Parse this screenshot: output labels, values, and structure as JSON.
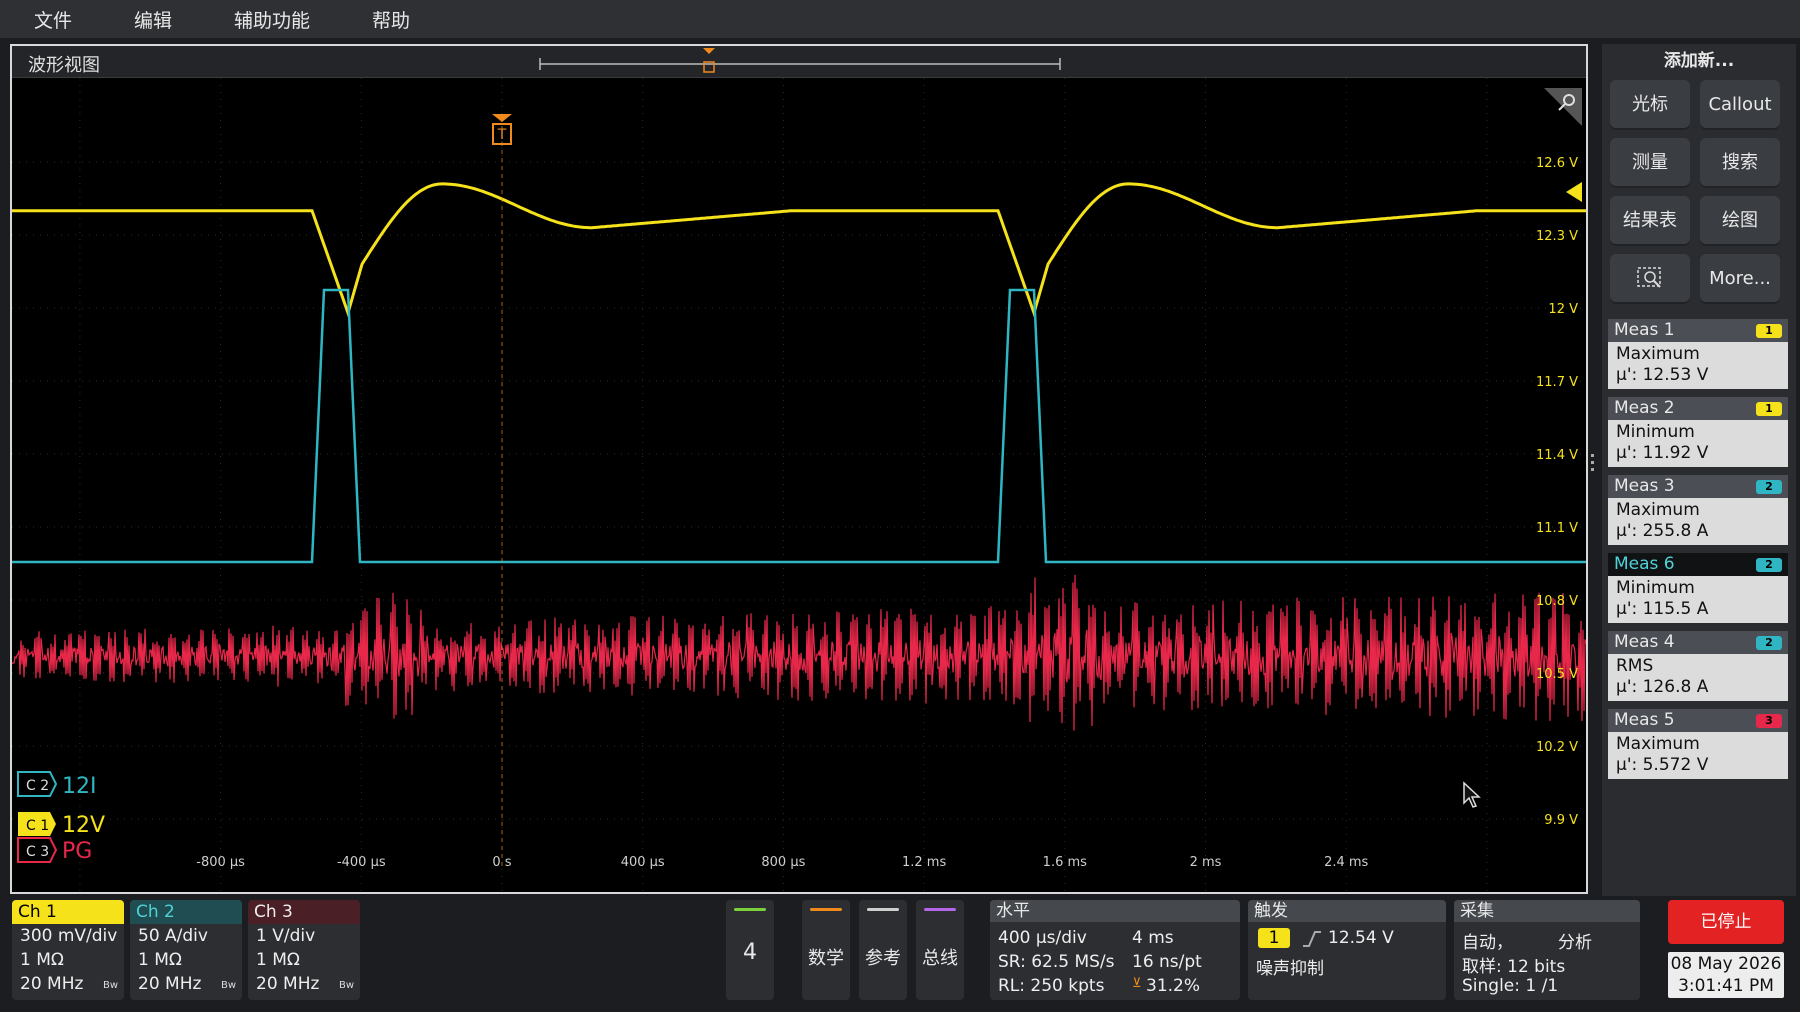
{
  "menu": [
    "文件",
    "编辑",
    "辅助功能",
    "帮助"
  ],
  "waveform_view": {
    "title": "波形视图",
    "x_ticks": [
      "-800 µs",
      "-400 µs",
      "0 s",
      "400 µs",
      "800 µs",
      "1.2 ms",
      "1.6 ms",
      "2 ms",
      "2.4 ms"
    ],
    "y_ticks": [
      "12.6 V",
      "12.3 V",
      "12 V",
      "11.7 V",
      "11.4 V",
      "11.1 V",
      "10.8 V",
      "10.5 V",
      "10.2 V",
      "9.9 V"
    ],
    "trigger_marker": "T",
    "channel_labels": [
      {
        "tag": "C 2",
        "name": "12I",
        "color": "#2fb6c2"
      },
      {
        "tag": "C 1",
        "name": "12V",
        "color": "#f5e21b"
      },
      {
        "tag": "C 3",
        "name": "PG",
        "color": "#e8284a"
      }
    ],
    "ch1_color": "#f5e21b",
    "ch2_color": "#2fb6c2",
    "ch3_color": "#e8284a"
  },
  "right_panel": {
    "add_new": "添加新...",
    "buttons": [
      "光标",
      "Callout",
      "测量",
      "搜索",
      "结果表",
      "绘图",
      "",
      "More..."
    ],
    "zoom_icon": "zoom-region-icon",
    "measurements": [
      {
        "name": "Meas 1",
        "badge": "1",
        "type": "Maximum",
        "value": "µ': 12.53 V",
        "selected": false
      },
      {
        "name": "Meas 2",
        "badge": "1",
        "type": "Minimum",
        "value": "µ': 11.92 V",
        "selected": false
      },
      {
        "name": "Meas 3",
        "badge": "2",
        "type": "Maximum",
        "value": "µ': 255.8 A",
        "selected": false
      },
      {
        "name": "Meas 6",
        "badge": "2",
        "type": "Minimum",
        "value": "µ': 115.5 A",
        "selected": true
      },
      {
        "name": "Meas 4",
        "badge": "2",
        "type": "RMS",
        "value": "µ': 126.8 A",
        "selected": false
      },
      {
        "name": "Meas 5",
        "badge": "3",
        "type": "Maximum",
        "value": "µ': 5.572 V",
        "selected": false
      }
    ]
  },
  "channels": [
    {
      "label": "Ch 1",
      "scale": "300 mV/div",
      "impedance": "1 MΩ",
      "bandwidth": "20 MHz",
      "bw": "Bw"
    },
    {
      "label": "Ch 2",
      "scale": "50 A/div",
      "impedance": "1 MΩ",
      "bandwidth": "20 MHz",
      "bw": "Bw"
    },
    {
      "label": "Ch 3",
      "scale": "1 V/div",
      "impedance": "1 MΩ",
      "bandwidth": "20 MHz",
      "bw": "Bw"
    }
  ],
  "add_buttons": [
    "4",
    "数学",
    "参考",
    "总线"
  ],
  "horizontal": {
    "title": "水平",
    "scale": "400 µs/div",
    "span": "4 ms",
    "sr": "SR: 62.5 MS/s",
    "pt": "16 ns/pt",
    "rl": "RL: 250 kpts",
    "pos": "31.2%"
  },
  "trigger": {
    "title": "触发",
    "source": "1",
    "level": "12.54 V",
    "noise": "噪声抑制"
  },
  "acquisition": {
    "title": "采集",
    "mode": "自动，",
    "analysis": "分析",
    "bits": "取样: 12 bits",
    "single": "Single: 1 /1"
  },
  "status": {
    "stopped": "已停止",
    "date": "08 May 2026",
    "time": "3:01:41 PM"
  }
}
